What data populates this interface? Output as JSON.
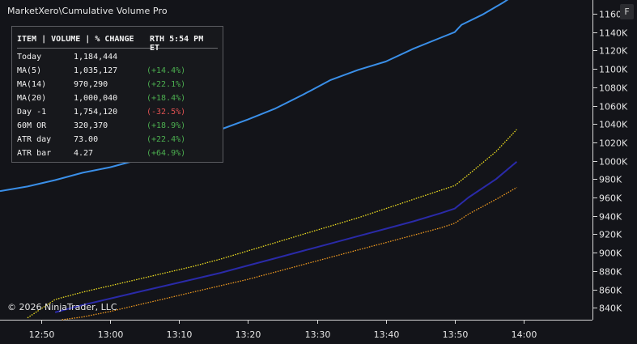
{
  "title": "MarketXero\\Cumulative Volume Pro",
  "float_button": "F",
  "copyright": "© 2026 NinjaTrader, LLC",
  "stats_table": {
    "header_left": "ITEM | VOLUME | % CHANGE",
    "header_right": "RTH 5:54 PM ET",
    "rows": [
      {
        "item": "Today",
        "volume": "1,184,444",
        "change": ""
      },
      {
        "item": "MA(5)",
        "volume": "1,035,127",
        "change": "(+14.4%)"
      },
      {
        "item": "MA(14)",
        "volume": "970,290",
        "change": "(+22.1%)"
      },
      {
        "item": "MA(20)",
        "volume": "1,000,040",
        "change": "(+18.4%)"
      },
      {
        "item": "Day -1",
        "volume": "1,754,120",
        "change": "(-32.5%)"
      },
      {
        "item": "60M OR",
        "volume": "320,370",
        "change": "(+18.9%)"
      },
      {
        "item": "ATR day",
        "volume": "73.00",
        "change": "(+22.4%)"
      },
      {
        "item": "ATR bar",
        "volume": "4.27",
        "change": "(+64.9%)"
      }
    ]
  },
  "chart_data": {
    "type": "line",
    "x_ticks": [
      "12:50",
      "13:00",
      "13:10",
      "13:20",
      "13:30",
      "13:40",
      "13:50",
      "14:00"
    ],
    "y_ticks": [
      840,
      860,
      880,
      900,
      920,
      940,
      960,
      980,
      1000,
      1020,
      1040,
      1060,
      1080,
      1100,
      1120,
      1140,
      1160
    ],
    "y_tick_labels": [
      "840K",
      "860K",
      "880K",
      "900K",
      "920K",
      "940K",
      "960K",
      "980K",
      "1000K",
      "1020K",
      "1040K",
      "1060K",
      "1080K",
      "1100K",
      "1120K",
      "1140K",
      "1160K"
    ],
    "xlim": [
      "12:44",
      "14:10"
    ],
    "ylim": [
      827,
      1175
    ],
    "grid": false,
    "series": [
      {
        "color": "#3a8fe8",
        "style": "solid",
        "x": [
          "12:44",
          "12:48",
          "12:52",
          "12:56",
          "13:00",
          "13:04",
          "13:08",
          "13:12",
          "13:16",
          "13:20",
          "13:24",
          "13:28",
          "13:32",
          "13:36",
          "13:40",
          "13:44",
          "13:48",
          "13:50",
          "13:51",
          "13:54",
          "13:57",
          "13:59"
        ],
        "values": [
          967,
          972,
          979,
          987,
          993,
          1001,
          1008,
          1020,
          1034,
          1045,
          1057,
          1072,
          1088,
          1099,
          1108,
          1122,
          1134,
          1140,
          1148,
          1159,
          1172,
          1182
        ]
      },
      {
        "color": "#f0e020",
        "style": "dotted",
        "x": [
          "12:48",
          "12:52",
          "12:56",
          "13:00",
          "13:04",
          "13:08",
          "13:12",
          "13:16",
          "13:20",
          "13:24",
          "13:28",
          "13:32",
          "13:36",
          "13:40",
          "13:44",
          "13:48",
          "13:50",
          "13:52",
          "13:56",
          "13:59"
        ],
        "values": [
          829,
          849,
          857,
          864,
          871,
          878,
          885,
          893,
          902,
          911,
          920,
          929,
          938,
          948,
          958,
          968,
          973,
          985,
          1010,
          1034
        ]
      },
      {
        "color": "#2a2aa8",
        "style": "solid",
        "x": [
          "12:52",
          "12:56",
          "13:00",
          "13:04",
          "13:08",
          "13:12",
          "13:16",
          "13:20",
          "13:24",
          "13:28",
          "13:32",
          "13:36",
          "13:40",
          "13:44",
          "13:48",
          "13:50",
          "13:52",
          "13:56",
          "13:59"
        ],
        "values": [
          835,
          843,
          850,
          857,
          864,
          871,
          878,
          886,
          894,
          902,
          910,
          918,
          926,
          934,
          943,
          948,
          960,
          980,
          999
        ]
      },
      {
        "color": "#f09a20",
        "style": "dotted",
        "x": [
          "12:53",
          "12:56",
          "13:00",
          "13:04",
          "13:08",
          "13:12",
          "13:16",
          "13:20",
          "13:24",
          "13:28",
          "13:32",
          "13:36",
          "13:40",
          "13:44",
          "13:48",
          "13:50",
          "13:52",
          "13:56",
          "13:59"
        ],
        "values": [
          827,
          830,
          836,
          843,
          850,
          857,
          864,
          871,
          879,
          887,
          895,
          903,
          911,
          919,
          927,
          932,
          942,
          958,
          971
        ]
      }
    ]
  }
}
